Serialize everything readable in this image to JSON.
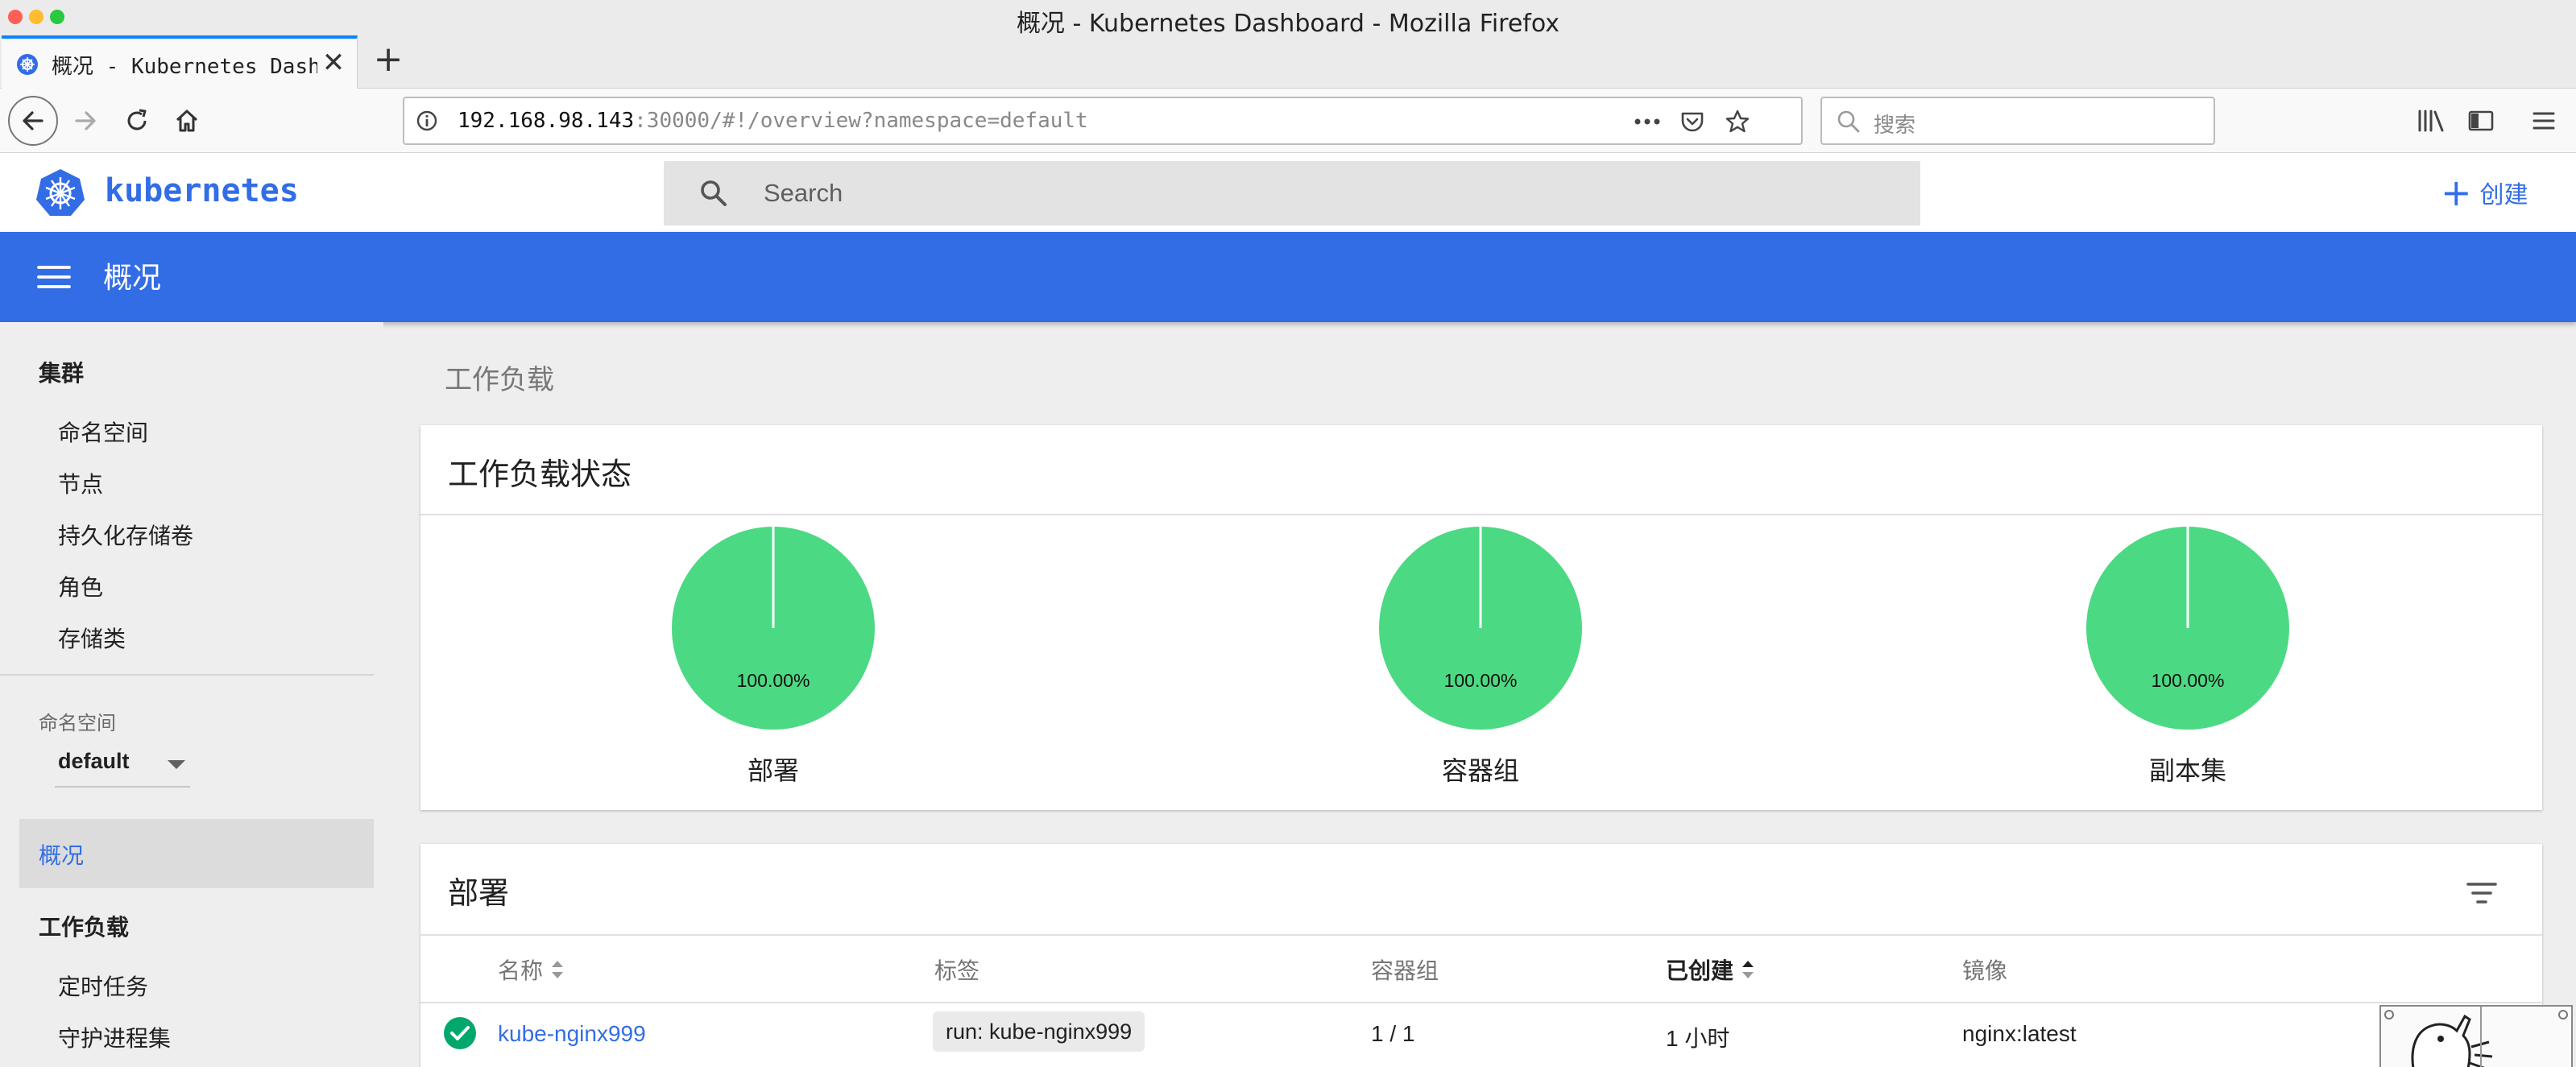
{
  "window": {
    "title": "概况 - Kubernetes Dashboard - Mozilla Firefox"
  },
  "browser": {
    "tab_title": "概况 - Kubernetes Dashboard",
    "tab_close": "✕",
    "new_tab": "+",
    "url_host": "192.168.98.143",
    "url_rest": ":30000/#!/overview?namespace=default",
    "search_placeholder": "搜索",
    "traffic_colors": [
      "#ff5f57",
      "#febc2e",
      "#28c840"
    ]
  },
  "app": {
    "brand": "kubernetes",
    "brand_color": "#326de6",
    "search_placeholder": "Search",
    "create_label": "创建",
    "page_title": "概况"
  },
  "sidebar": {
    "cluster_heading": "集群",
    "cluster_items": [
      "命名空间",
      "节点",
      "持久化存储卷",
      "角色",
      "存储类"
    ],
    "namespace_label": "命名空间",
    "namespace_value": "default",
    "active_item": "概况",
    "workloads_heading": "工作负载",
    "workload_items": [
      "定时任务",
      "守护进程集"
    ]
  },
  "main": {
    "section_title": "工作负载",
    "status_card": {
      "title": "工作负载状态",
      "charts": [
        {
          "percent_label": "100.00%",
          "label": "部署",
          "value": 100,
          "color": "#4cd983"
        },
        {
          "percent_label": "100.00%",
          "label": "容器组",
          "value": 100,
          "color": "#4cd983"
        },
        {
          "percent_label": "100.00%",
          "label": "副本集",
          "value": 100,
          "color": "#4cd983"
        }
      ]
    },
    "deployments_card": {
      "title": "部署",
      "columns": [
        "名称",
        "标签",
        "容器组",
        "已创建",
        "镜像"
      ],
      "rows": [
        {
          "status": "ok",
          "name": "kube-nginx999",
          "labels": "run: kube-nginx999",
          "pods": "1 / 1",
          "created": "1 小时",
          "image": "nginx:latest"
        }
      ]
    }
  }
}
